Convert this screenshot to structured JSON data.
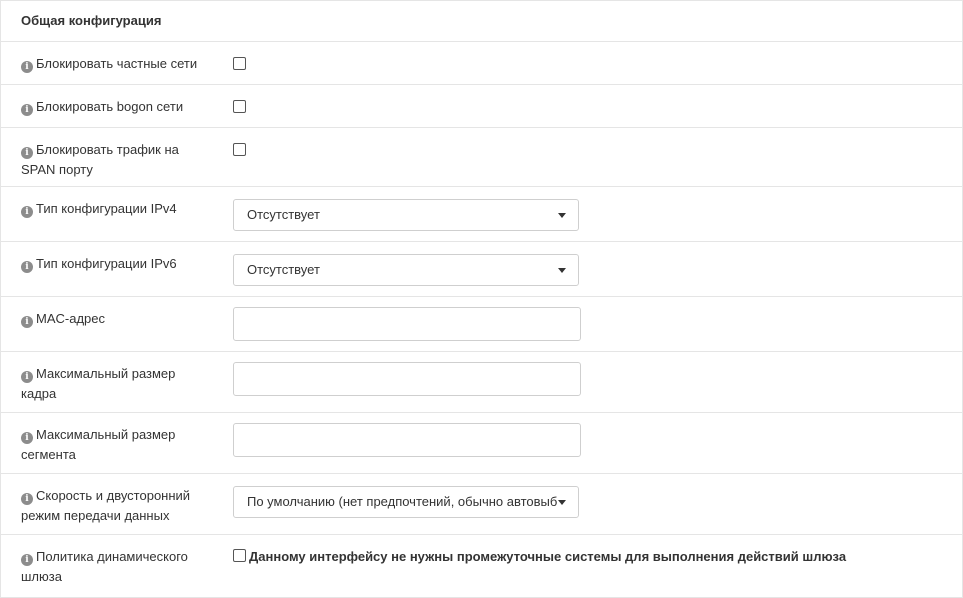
{
  "section": {
    "title": "Общая конфигурация"
  },
  "rows": [
    {
      "label": "Блокировать частные сети",
      "control": "checkbox"
    },
    {
      "label": "Блокировать bogon сети",
      "control": "checkbox"
    },
    {
      "label": "Блокировать трафик на SPAN порту",
      "control": "checkbox"
    },
    {
      "label": "Тип конфигурации IPv4",
      "control": "select",
      "value": "Отсутствует"
    },
    {
      "label": "Тип конфигурации IPv6",
      "control": "select",
      "value": "Отсутствует"
    },
    {
      "label": "MAC-адрес",
      "control": "input",
      "value": ""
    },
    {
      "label": "Максимальный размер кадра",
      "control": "input",
      "value": ""
    },
    {
      "label": "Максимальный размер сегмента",
      "control": "input",
      "value": ""
    },
    {
      "label": "Скорость и двусторонний режим передачи данных",
      "control": "select",
      "value": "По умолчанию (нет предпочтений, обычно автовыбор)"
    },
    {
      "label": "Политика динамического шлюза",
      "control": "checkbox",
      "text": "Данному интерфейсу не нужны промежуточные системы для выполнения действий шлюза"
    }
  ],
  "icons": {
    "info": "info-icon",
    "caret": "caret-down-icon"
  },
  "colors": {
    "border": "#e5e5e5",
    "info_icon": "#8c8c8c",
    "text": "#333333"
  }
}
